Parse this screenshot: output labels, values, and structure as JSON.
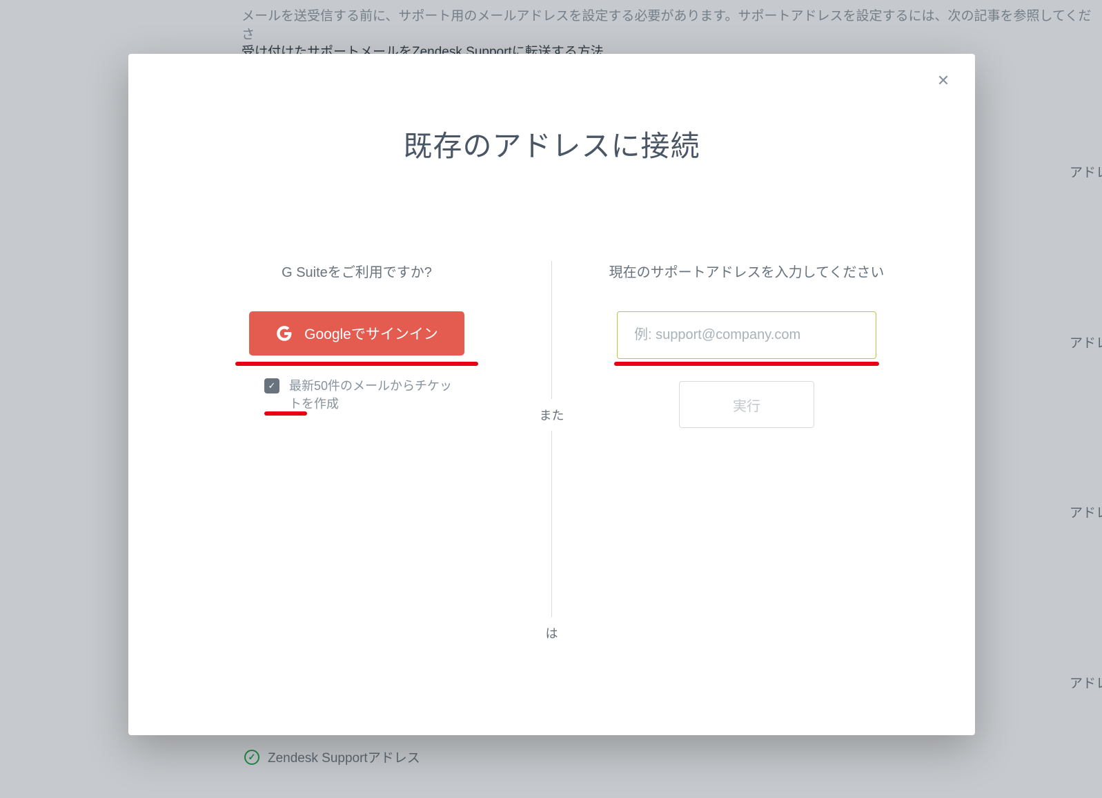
{
  "background": {
    "intro_line": "メールを送受信する前に、サポート用のメールアドレスを設定する必要があります。サポートアドレスを設定するには、次の記事を参照してくださ",
    "link_line": "受け付けたサポートメールをZendesk Supportに転送する方法",
    "side_label": "アドレ",
    "bottom_address_label": "Zendesk Supportアドレス"
  },
  "modal": {
    "title": "既存のアドレスに接続",
    "close_label": "✕",
    "divider_word_1": "また",
    "divider_word_2": "は",
    "left": {
      "subtitle": "G Suiteをご利用ですか?",
      "google_button": "Googleでサインイン",
      "checkbox_label": "最新50件のメールからチケットを作成"
    },
    "right": {
      "subtitle": "現在のサポートアドレスを入力してください",
      "email_placeholder": "例: support@company.com",
      "exec_button": "実行"
    }
  }
}
